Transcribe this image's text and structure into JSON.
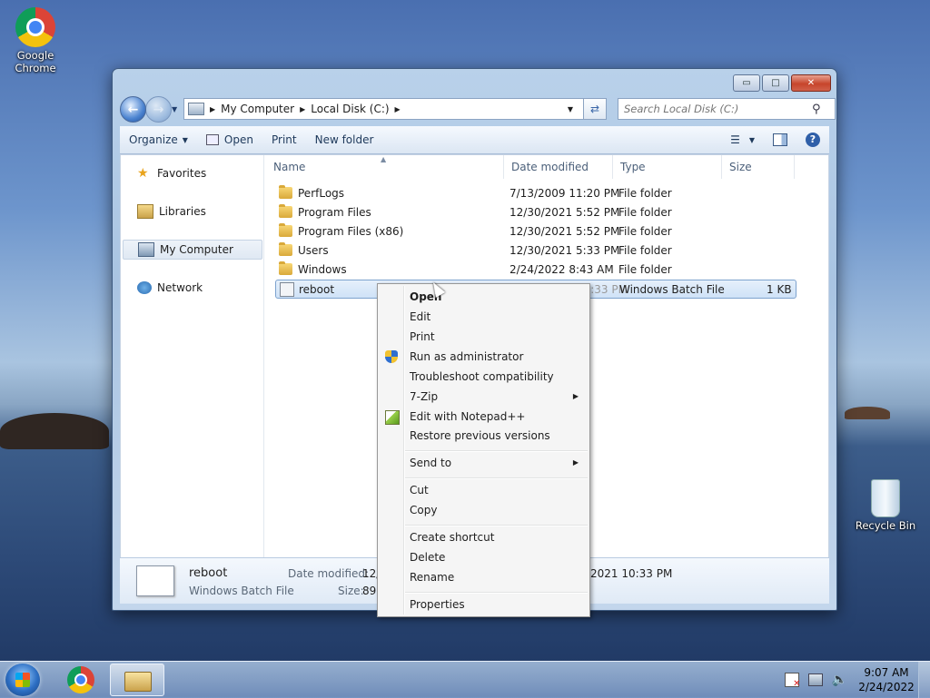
{
  "desktop": {
    "chrome_label": "Google Chrome",
    "recycle_label": "Recycle Bin"
  },
  "window": {
    "breadcrumb": [
      "My Computer",
      "Local Disk (C:)"
    ],
    "search_placeholder": "Search Local Disk (C:)",
    "caption": {
      "minimize": "▭",
      "maximize": "□",
      "close": "✕"
    }
  },
  "toolbar": {
    "organize": "Organize",
    "open": "Open",
    "print": "Print",
    "new_folder": "New folder"
  },
  "nav": {
    "favorites": "Favorites",
    "libraries": "Libraries",
    "my_computer": "My Computer",
    "network": "Network"
  },
  "columns": {
    "name": "Name",
    "date_modified": "Date modified",
    "type": "Type",
    "size": "Size"
  },
  "files": [
    {
      "name": "PerfLogs",
      "date": "7/13/2009 11:20 PM",
      "type": "File folder",
      "size": ""
    },
    {
      "name": "Program Files",
      "date": "12/30/2021 5:52 PM",
      "type": "File folder",
      "size": ""
    },
    {
      "name": "Program Files (x86)",
      "date": "12/30/2021 5:52 PM",
      "type": "File folder",
      "size": ""
    },
    {
      "name": "Users",
      "date": "12/30/2021 5:33 PM",
      "type": "File folder",
      "size": ""
    },
    {
      "name": "Windows",
      "date": "2/24/2022 8:43 AM",
      "type": "File folder",
      "size": ""
    },
    {
      "name": "reboot",
      "date": "12/30/2021 10:33 PM",
      "type": "Windows Batch File",
      "size": "1 KB"
    }
  ],
  "details": {
    "name": "reboot",
    "type": "Windows Batch File",
    "date_label": "Date modified:",
    "date_value": "12/",
    "date_tail": "2021 10:33 PM",
    "size_label": "Size:",
    "size_value": "89"
  },
  "context_menu": {
    "open": "Open",
    "edit": "Edit",
    "print": "Print",
    "run_admin": "Run as administrator",
    "troubleshoot": "Troubleshoot compatibility",
    "seven_zip": "7-Zip",
    "notepadpp": "Edit with Notepad++",
    "restore": "Restore previous versions",
    "send_to": "Send to",
    "cut": "Cut",
    "copy": "Copy",
    "create_shortcut": "Create shortcut",
    "delete": "Delete",
    "rename": "Rename",
    "properties": "Properties"
  },
  "taskbar": {
    "time": "9:07 AM",
    "date": "2/24/2022"
  }
}
